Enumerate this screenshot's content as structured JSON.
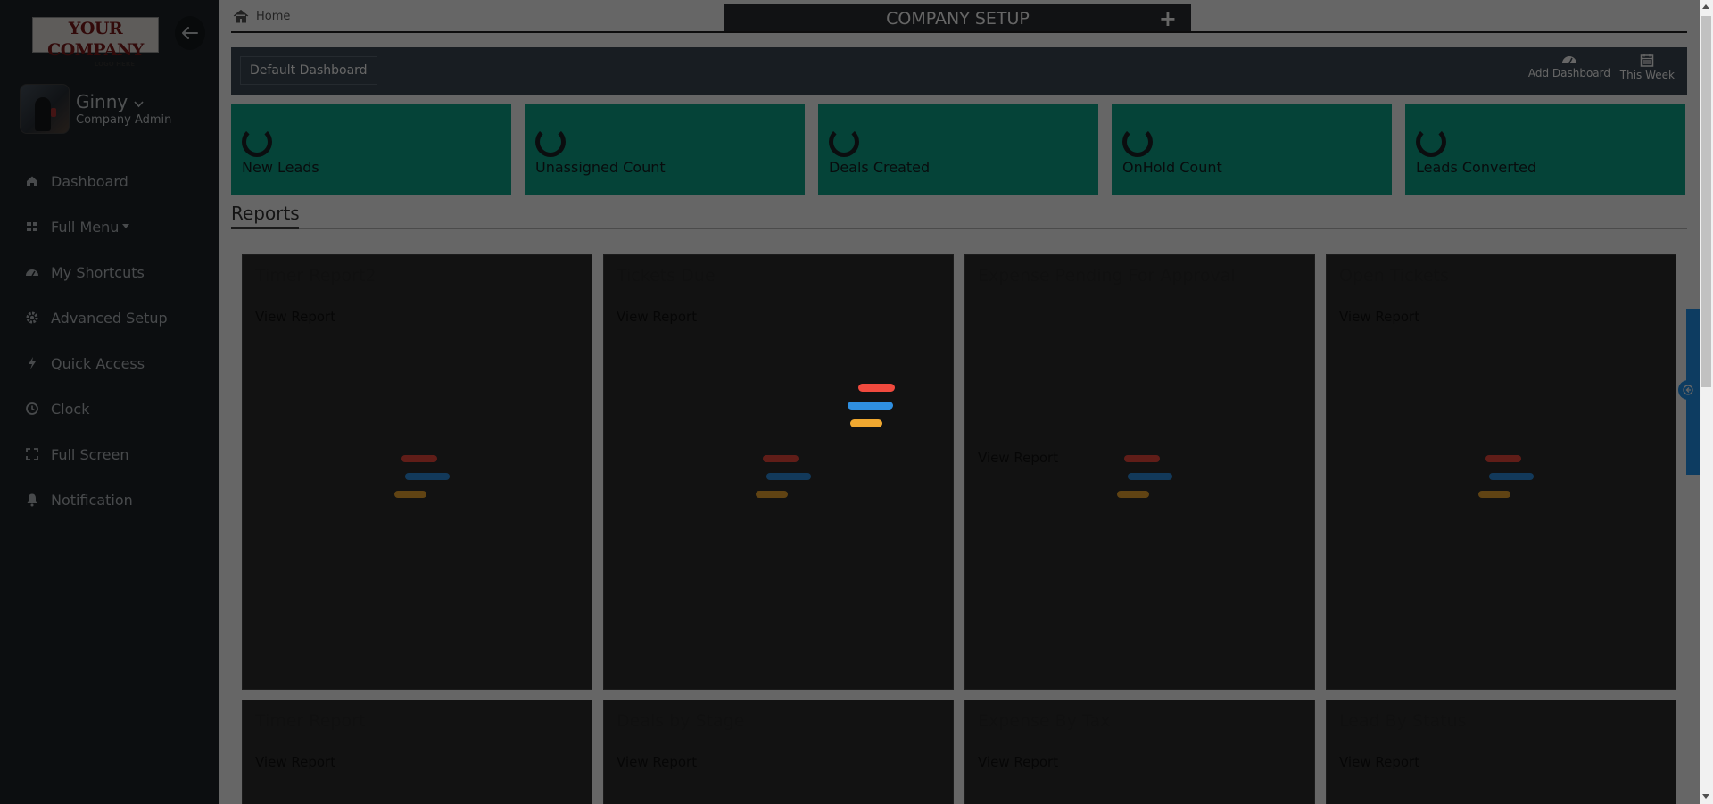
{
  "brand": {
    "logo_main": "YOUR COMPANY",
    "logo_sub": "LOGO HERE"
  },
  "user": {
    "name": "Ginny",
    "role": "Company Admin"
  },
  "nav": {
    "items": [
      {
        "label": "Dashboard",
        "icon": "home-icon"
      },
      {
        "label": "Full Menu",
        "icon": "grid-icon"
      },
      {
        "label": "My Shortcuts",
        "icon": "dashboard-icon"
      },
      {
        "label": "Advanced Setup",
        "icon": "gear-icon"
      },
      {
        "label": "Quick Access",
        "icon": "bolt-icon"
      },
      {
        "label": "Clock",
        "icon": "clock-icon"
      },
      {
        "label": "Full Screen",
        "icon": "expand-icon"
      },
      {
        "label": "Notification",
        "icon": "bell-icon"
      }
    ]
  },
  "breadcrumb": {
    "home": "Home"
  },
  "header": {
    "title": "COMPANY SETUP",
    "add_symbol": "+"
  },
  "dashboard": {
    "selected": "Default Dashboard",
    "add_label": "Add Dashboard",
    "period_label": "This Week"
  },
  "stats": [
    {
      "label": "New Leads"
    },
    {
      "label": "Unassigned Count"
    },
    {
      "label": "Deals Created"
    },
    {
      "label": "OnHold Count"
    },
    {
      "label": "Leads Converted"
    }
  ],
  "reports": {
    "title": "Reports",
    "cards": [
      {
        "title": "Timer Report2",
        "link": "View Report"
      },
      {
        "title": "Tickets Due",
        "link": "View Report"
      },
      {
        "title": "Expense Pending For Approval",
        "link": "View Report"
      },
      {
        "title": "Open Tickets",
        "link": "View Report"
      },
      {
        "title": "Timer Report",
        "link": "View Report"
      },
      {
        "title": "Deals by Stage",
        "link": "View Report"
      },
      {
        "title": "Expense By Tax",
        "link": "View Report"
      },
      {
        "title": "Lead By Status",
        "link": "View Report"
      }
    ]
  },
  "colors": {
    "sidebar": "#1f2429",
    "stat_card": "#0ea88c",
    "loader_red": "#f04a3e",
    "loader_blue": "#2f8fe0",
    "loader_yellow": "#f0a830",
    "side_tab": "#2196f3"
  }
}
